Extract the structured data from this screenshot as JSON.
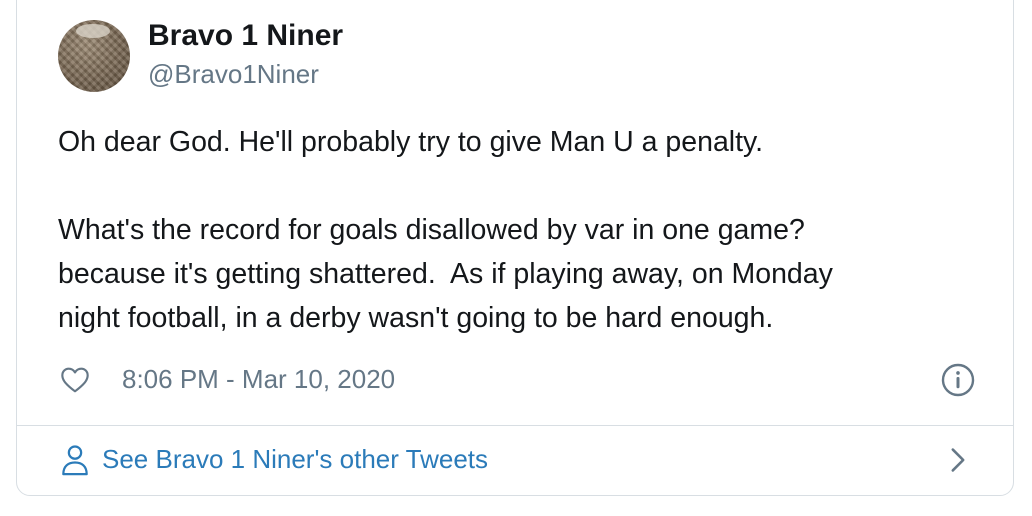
{
  "author": {
    "display_name": "Bravo 1 Niner",
    "handle": "@Bravo1Niner",
    "avatar_icon": "woven-basket-avatar"
  },
  "tweet": {
    "paragraph_1": "Oh dear God. He'll probably try to give Man U a penalty.",
    "paragraph_2": "What's the record for goals disallowed by var in one game?\nbecause it's getting shattered.  As if playing away, on Monday\nnight football, in a derby wasn't going to be hard enough."
  },
  "meta": {
    "like_icon": "heart-outline-icon",
    "timestamp": "8:06 PM - Mar 10, 2020",
    "info_icon": "info-circle-icon"
  },
  "footer": {
    "icon": "person-icon",
    "link_text": "See Bravo 1 Niner's other Tweets",
    "chevron_icon": "chevron-right-icon"
  },
  "colors": {
    "text_primary": "#14171a",
    "text_secondary": "#657786",
    "link": "#2b7bb9",
    "border": "#d8dee3"
  }
}
